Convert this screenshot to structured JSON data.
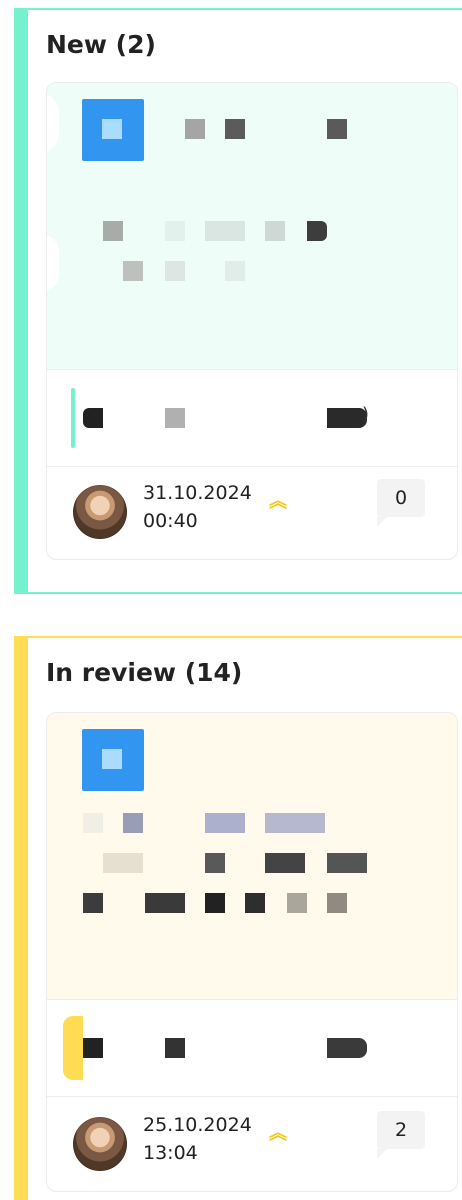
{
  "colors": {
    "new_accent": "#74f1cd",
    "review_accent": "#ffdc53",
    "card_new_bg": "#effdf8",
    "card_review_bg": "#fffaeb",
    "priority_icon": "#f4c817",
    "tile_icon": "#3296f0"
  },
  "columns": [
    {
      "title": "New (2)",
      "card": {
        "mid_symbol": ")",
        "date": "31.10.2024",
        "time": "00:40",
        "priority_icon": "chevrons-up-icon",
        "comments": "0"
      }
    },
    {
      "title": "In review (14)",
      "card": {
        "date": "25.10.2024",
        "time": "13:04",
        "priority_icon": "chevrons-up-icon",
        "comments": "2"
      }
    }
  ]
}
